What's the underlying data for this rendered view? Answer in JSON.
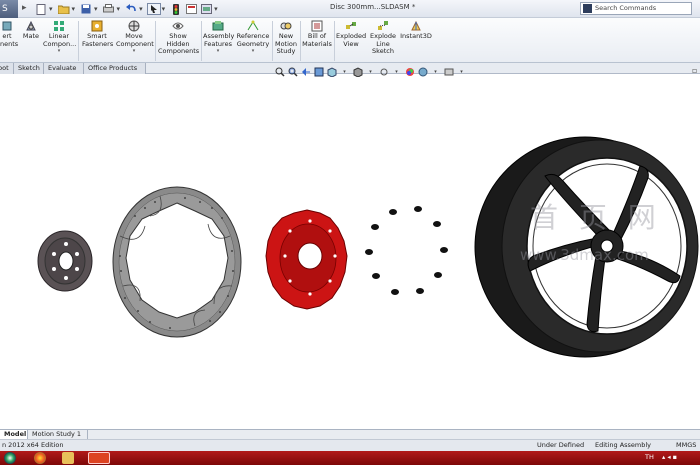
{
  "titlebar": {
    "document_title": "Disc 300mm...SLDASM *",
    "search_placeholder": "Search Commands"
  },
  "ribbon": {
    "insert_components": "ert\nonents",
    "mate": "Mate",
    "linear_pattern": "Linear\nCompon...",
    "smart_fasteners": "Smart\nFasteners",
    "move_component": "Move\nComponent",
    "show_hidden": "Show\nHidden\nComponents",
    "assembly_features": "Assembly\nFeatures",
    "reference_geometry": "Reference\nGeometry",
    "new_motion_study": "New\nMotion\nStudy",
    "bill_of_materials": "Bill of\nMaterials",
    "exploded_view": "Exploded\nView",
    "explode_line_sketch": "Explode\nLine\nSketch",
    "instant3d": "Instant3D"
  },
  "tabs": [
    "bot",
    "Sketch",
    "Evaluate",
    "Office Products"
  ],
  "bottom_tabs": [
    "Model",
    "Motion Study 1"
  ],
  "status": {
    "edition": "n 2012 x64 Edition",
    "state": "Under Defined",
    "mode": "Editing Assembly",
    "units": "MMGS"
  },
  "watermark": {
    "line1": "首 页 网",
    "line2": "www.3dmax.com"
  },
  "taskbar": {
    "lang": "TH"
  },
  "colors": {
    "caliper_red": "#cc1414",
    "disc_grey": "#8a8a8a",
    "hub_grey": "#5a5255",
    "wheel_black": "#202020",
    "taskbar_red": "#a31212"
  }
}
